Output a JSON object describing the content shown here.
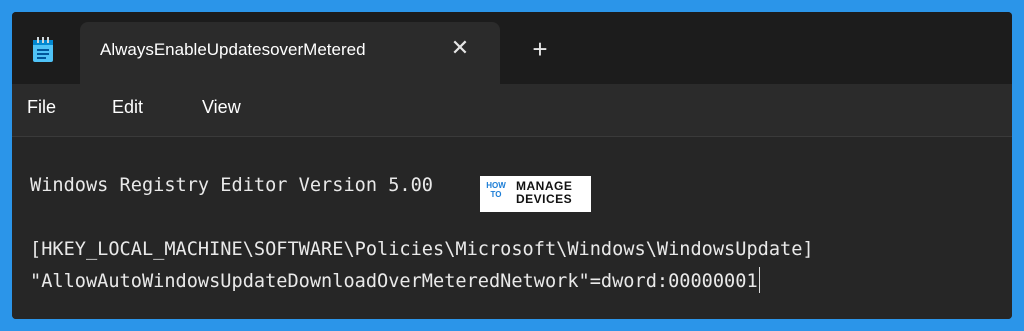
{
  "tab": {
    "title": "AlwaysEnableUpdatesoverMetered",
    "close_label": "✕",
    "new_tab_label": "+"
  },
  "menu": {
    "items": [
      {
        "label": "File"
      },
      {
        "label": "Edit"
      },
      {
        "label": "View"
      }
    ]
  },
  "editor": {
    "lines": [
      "Windows Registry Editor Version 5.00",
      "",
      "[HKEY_LOCAL_MACHINE\\SOFTWARE\\Policies\\Microsoft\\Windows\\WindowsUpdate]",
      "\"AllowAutoWindowsUpdateDownloadOverMeteredNetwork\"=dword:00000001"
    ]
  },
  "watermark": {
    "line1": "HOW",
    "line2": "TO",
    "line3": "MANAGE",
    "line4": "DEVICES"
  },
  "colors": {
    "background": "#2b95e9",
    "window": "#262626",
    "titlebar": "#1c1c1c"
  }
}
